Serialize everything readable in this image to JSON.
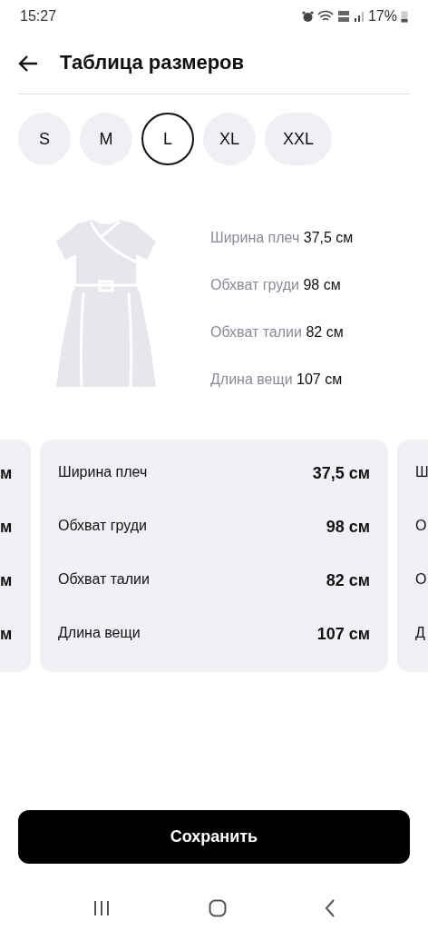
{
  "status_bar": {
    "time": "15:27",
    "battery": "17%"
  },
  "header": {
    "title": "Таблица размеров"
  },
  "sizes": [
    {
      "label": "S",
      "selected": false
    },
    {
      "label": "M",
      "selected": false
    },
    {
      "label": "L",
      "selected": true
    },
    {
      "label": "XL",
      "selected": false
    },
    {
      "label": "XXL",
      "selected": false
    }
  ],
  "summary": [
    {
      "label": "Ширина плеч",
      "value": "37,5 см"
    },
    {
      "label": "Обхват груди",
      "value": "98 см"
    },
    {
      "label": "Обхват талии",
      "value": "82 см"
    },
    {
      "label": "Длина вещи",
      "value": "107 см"
    }
  ],
  "cards": [
    {
      "kind": "partial_left",
      "rows": [
        {
          "value": "м"
        },
        {
          "value": "м"
        },
        {
          "value": "м"
        },
        {
          "value": "м"
        }
      ]
    },
    {
      "kind": "full",
      "rows": [
        {
          "label": "Ширина плеч",
          "value": "37,5 см"
        },
        {
          "label": "Обхват груди",
          "value": "98 см"
        },
        {
          "label": "Обхват талии",
          "value": "82 см"
        },
        {
          "label": "Длина вещи",
          "value": "107 см"
        }
      ]
    },
    {
      "kind": "partial_right",
      "rows": [
        {
          "label": "Ш"
        },
        {
          "label": "О"
        },
        {
          "label": "О"
        },
        {
          "label": "Д"
        }
      ]
    }
  ],
  "save_button": "Сохранить"
}
